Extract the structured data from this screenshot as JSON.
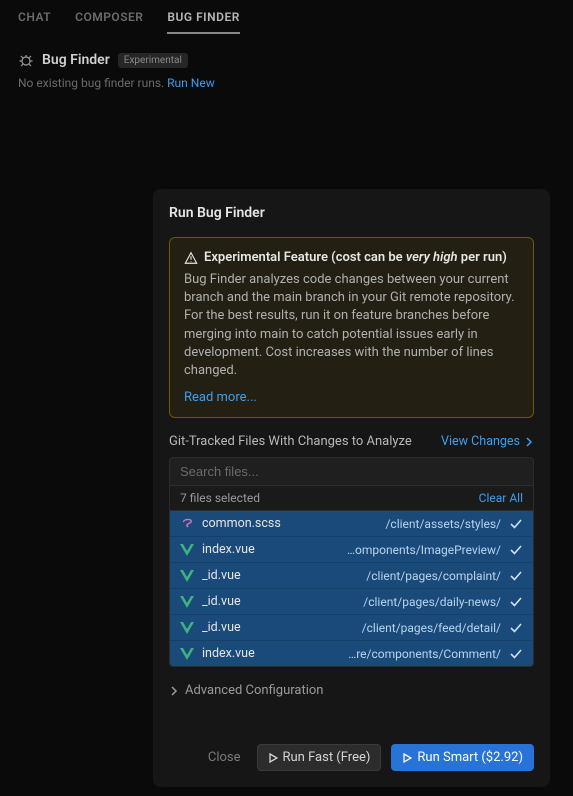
{
  "tabs": {
    "chat": "CHAT",
    "composer": "COMPOSER",
    "bugfinder": "BUG FINDER"
  },
  "header": {
    "title": "Bug Finder",
    "badge": "Experimental",
    "subtitle_prefix": "No existing bug finder runs. ",
    "run_new": "Run New"
  },
  "panel": {
    "title": "Run Bug Finder",
    "notice": {
      "head_prefix": "Experimental Feature (cost can be ",
      "head_em": "very high",
      "head_suffix": " per run)",
      "body": "Bug Finder analyzes code changes between your current branch and the main branch in your Git remote repository. For the best results, run it on feature branches before merging into main to catch potential issues early in development. Cost increases with the number of lines changed.",
      "link": "Read more..."
    },
    "files": {
      "label": "Git-Tracked Files With Changes to Analyze",
      "view": "View Changes",
      "search_placeholder": "Search files...",
      "count_label": "7 files selected",
      "clear": "Clear All",
      "list": [
        {
          "name": "common.scss",
          "path": "/client/assets/styles/",
          "type": "scss"
        },
        {
          "name": "index.vue",
          "path": "…omponents/ImagePreview/",
          "type": "vue"
        },
        {
          "name": "_id.vue",
          "path": "/client/pages/complaint/",
          "type": "vue"
        },
        {
          "name": "_id.vue",
          "path": "/client/pages/daily-news/",
          "type": "vue"
        },
        {
          "name": "_id.vue",
          "path": "/client/pages/feed/detail/",
          "type": "vue"
        },
        {
          "name": "index.vue",
          "path": "…re/components/Comment/",
          "type": "vue"
        }
      ]
    },
    "advanced": "Advanced Configuration",
    "footer": {
      "close": "Close",
      "fast": "Run Fast (Free)",
      "smart": "Run Smart ($2.92)"
    }
  }
}
